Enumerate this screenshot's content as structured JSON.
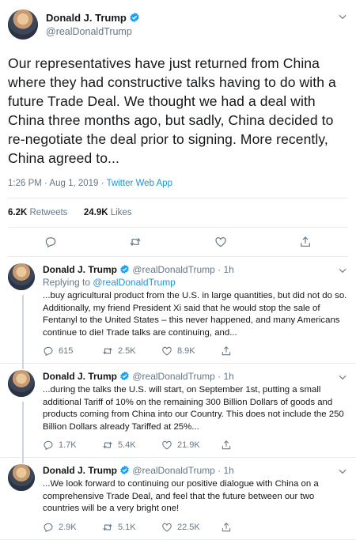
{
  "main": {
    "name": "Donald J. Trump",
    "handle": "@realDonaldTrump",
    "text": "Our representatives have just returned from China where they had constructive talks having to do with a future Trade Deal. We thought we had a deal with China three months ago, but sadly, China decided to re-negotiate the deal prior to signing. More recently, China agreed to...",
    "timestamp": "1:26 PM · Aug 1, 2019 · ",
    "source": "Twitter Web App",
    "retweets_count": "6.2K",
    "retweets_label": "Retweets",
    "likes_count": "24.9K",
    "likes_label": "Likes"
  },
  "replies": [
    {
      "name": "Donald J. Trump",
      "handle": "@realDonaldTrump · 1h",
      "replying_prefix": "Replying to ",
      "replying_handle": "@realDonaldTrump",
      "text": "...buy agricultural product from the U.S. in large quantities, but did not do so. Additionally, my friend President Xi said that he would stop the sale of Fentanyl to the United States – this never happened, and many Americans continue to die! Trade talks are continuing, and...",
      "replies": "615",
      "retweets": "2.5K",
      "likes": "8.9K"
    },
    {
      "name": "Donald J. Trump",
      "handle": "@realDonaldTrump · 1h",
      "text": "...during the talks the U.S. will start, on September 1st, putting a small additional Tariff of 10% on the remaining 300 Billion Dollars of goods and products coming from China into our Country. This does not include the 250 Billion Dollars already Tariffed at 25%...",
      "replies": "1.7K",
      "retweets": "5.4K",
      "likes": "21.9K"
    },
    {
      "name": "Donald J. Trump",
      "handle": "@realDonaldTrump · 1h",
      "text": "...We look forward to continuing our positive dialogue with China on a comprehensive Trade Deal, and feel that the future between our two countries will be a very bright one!",
      "replies": "2.9K",
      "retweets": "5.1K",
      "likes": "22.5K"
    }
  ],
  "colors": {
    "accent": "#1da1f2",
    "muted": "#657786",
    "text": "#14171a",
    "border": "#e6ecf0"
  },
  "icons": [
    "verified-badge-icon",
    "chevron-down-icon",
    "reply-icon",
    "retweet-icon",
    "like-icon",
    "share-icon"
  ]
}
